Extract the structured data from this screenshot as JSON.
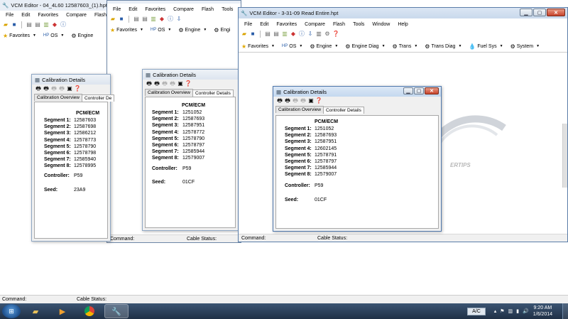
{
  "back_window": {
    "title": "VCM Editor - 04_4L60 12587603_(1).hpt",
    "menu": [
      "File",
      "Edit",
      "Favorites",
      "Compare",
      "Flash"
    ],
    "links": [
      "Favorites",
      "OS",
      "Engine"
    ],
    "status": {
      "command": "Command:",
      "cable": "Cable Status:"
    }
  },
  "mid_window": {
    "title": "",
    "menu": [
      "File",
      "Edit",
      "Favorites",
      "Compare",
      "Flash",
      "Tools"
    ],
    "links": [
      "Favorites",
      "OS",
      "Engine",
      "Engi"
    ],
    "status": {
      "command": "Command:",
      "cable": "Cable Status:"
    }
  },
  "front_window": {
    "title": "VCM Editor - 3-31-09 Read Entire.hpt",
    "menu": [
      "File",
      "Edit",
      "Favorites",
      "Compare",
      "Flash",
      "Tools",
      "Window",
      "Help"
    ],
    "links": [
      "Favorites",
      "OS",
      "Engine",
      "Engine Diag",
      "Trans",
      "Trans Diag",
      "Fuel Sys",
      "System"
    ],
    "status": {
      "command": "Command:",
      "cable": "Cable Status:"
    }
  },
  "dialog_back": {
    "title": "Calibration Details",
    "tabs": [
      "Calibration Overview",
      "Controller De"
    ],
    "header": "PCM/ECM",
    "segments": [
      {
        "label": "Segment 1:",
        "value": "12587603"
      },
      {
        "label": "Segment 2:",
        "value": "12587698"
      },
      {
        "label": "Segment 3:",
        "value": "12586212"
      },
      {
        "label": "Segment 4:",
        "value": "12578773"
      },
      {
        "label": "Segment 5:",
        "value": "12578790"
      },
      {
        "label": "Segment 6:",
        "value": "12578798"
      },
      {
        "label": "Segment 7:",
        "value": "12585940"
      },
      {
        "label": "Segment 8:",
        "value": "12578995"
      }
    ],
    "controller": {
      "label": "Controller:",
      "value": "P59"
    },
    "seed": {
      "label": "Seed:",
      "value": "23A9"
    }
  },
  "dialog_mid": {
    "title": "Calibration Details",
    "tabs": [
      "Calibration Overview",
      "Controller Details"
    ],
    "header": "PCM/ECM",
    "segments": [
      {
        "label": "Segment 1:",
        "value": "1251052"
      },
      {
        "label": "Segment 2:",
        "value": "12587693"
      },
      {
        "label": "Segment 3:",
        "value": "12587951"
      },
      {
        "label": "Segment 4:",
        "value": "12578772"
      },
      {
        "label": "Segment 5:",
        "value": "12578790"
      },
      {
        "label": "Segment 6:",
        "value": "12578797"
      },
      {
        "label": "Segment 7:",
        "value": "12585944"
      },
      {
        "label": "Segment 8:",
        "value": "12579007"
      }
    ],
    "controller": {
      "label": "Controller:",
      "value": "P59"
    },
    "seed": {
      "label": "Seed:",
      "value": "01CF"
    }
  },
  "dialog_front": {
    "title": "Calibration Details",
    "tabs": [
      "Calibration Overview",
      "Controller Details"
    ],
    "header": "PCM/ECM",
    "segments": [
      {
        "label": "Segment 1:",
        "value": "1251052"
      },
      {
        "label": "Segment 2:",
        "value": "12587693"
      },
      {
        "label": "Segment 3:",
        "value": "12587951"
      },
      {
        "label": "Segment 4:",
        "value": "12602145"
      },
      {
        "label": "Segment 5:",
        "value": "12578791"
      },
      {
        "label": "Segment 6:",
        "value": "12578797"
      },
      {
        "label": "Segment 7:",
        "value": "12585944"
      },
      {
        "label": "Segment 8:",
        "value": "12579007"
      }
    ],
    "controller": {
      "label": "Controller:",
      "value": "P59"
    },
    "seed": {
      "label": "Seed:",
      "value": "01CF"
    }
  },
  "logo_text": "ERTIPS",
  "bottom_strip": {
    "command": "Command:",
    "cable": "Cable Status:"
  },
  "taskbar": {
    "apps": [
      "folder-icon",
      "media-icon",
      "chrome-icon",
      "vcm-editor-icon"
    ],
    "ac": "A/C",
    "time": "9:20 AM",
    "date": "1/6/2014"
  },
  "colors": {
    "title_inactive": "#e8eef6",
    "title_active": "#c4d8ef",
    "taskbar": "#1f3046"
  }
}
